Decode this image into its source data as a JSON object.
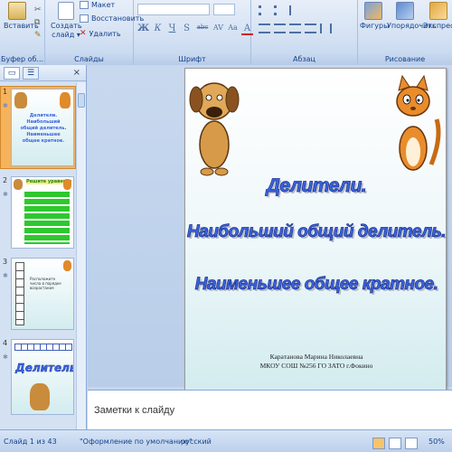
{
  "ribbon": {
    "clipboard": {
      "paste_label": "Вставить",
      "group_label": "Буфер об...",
      "cut_icon": "scissors-icon",
      "copy_icon": "copy-icon",
      "format_icon": "format-painter-icon"
    },
    "slides": {
      "create_label": "Создать\nслайд",
      "create_dropdown": "▾",
      "layout_label": "Макет",
      "reset_label": "Восстановить",
      "delete_label": "Удалить",
      "group_label": "Слайды"
    },
    "font": {
      "group_label": "Шрифт",
      "format_buttons": [
        "Ж",
        "К",
        "Ч",
        "S",
        "abc",
        "AV",
        "Aa",
        "A"
      ]
    },
    "paragraph": {
      "group_label": "Абзац"
    },
    "drawing": {
      "shapes_label": "Фигуры",
      "arrange_label": "Упорядочить",
      "express_label": "Экспресс",
      "group_label": "Рисование"
    }
  },
  "panel": {
    "tabs": [
      "slides-tab",
      "outline-tab"
    ],
    "close": "×",
    "thumbnails": [
      {
        "num": "1",
        "text": "Делители. Наибольший общий делитель. Наименьшее общее кратное.",
        "selected": true
      },
      {
        "num": "2",
        "text": "Решите уравнения",
        "selected": false
      },
      {
        "num": "3",
        "text": "Расположите числа в порядке возрастания",
        "selected": false
      },
      {
        "num": "4",
        "text": "Делитель",
        "selected": false
      }
    ]
  },
  "slide": {
    "title_lines": [
      "Делители.",
      "Наибольший общий делитель.",
      "Наименьшее общее кратное."
    ],
    "author_lines": [
      "Каратанова Марина Николаевна",
      "МКОУ СОШ №256 ГО ЗАТО г.Фокино"
    ]
  },
  "notes": {
    "placeholder": "Заметки к слайду"
  },
  "status": {
    "slide_info": "Слайд 1 из 43",
    "theme": "\"Оформление по умолчанию\"",
    "language": "русский",
    "zoom": "50%"
  },
  "colors": {
    "title_fill": "#3b66e0",
    "title_outline": "#1a2f8c",
    "selected_thumb": "#f6b35c"
  }
}
